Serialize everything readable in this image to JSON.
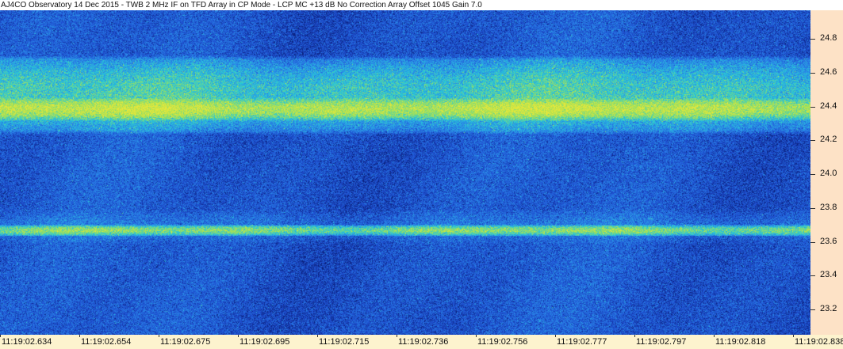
{
  "window": {
    "title": "AJ4CO Observatory 14 Dec 2015 - TWB 2 MHz IF on TFD Array in CP Mode - LCP  MC +13 dB  No Correction Array  Offset 1045  Gain 7.0"
  },
  "chart_data": {
    "type": "heatmap",
    "title": "AJ4CO Observatory 14 Dec 2015 - TWB 2 MHz IF on TFD Array in CP Mode - LCP  MC +13 dB  No Correction Array  Offset 1045  Gain 7.0",
    "xlabel": "",
    "ylabel": "",
    "x_tick_labels": [
      "11:19:02.634",
      "11:19:02.654",
      "11:19:02.675",
      "11:19:02.695",
      "11:19:02.715",
      "11:19:02.736",
      "11:19:02.756",
      "11:19:02.777",
      "11:19:02.797",
      "11:19:02.818",
      "11:19:02.838"
    ],
    "x_range": [
      "11:19:02.634",
      "11:19:02.838"
    ],
    "y_tick_values": [
      24.8,
      24.6,
      24.4,
      24.2,
      24.0,
      23.8,
      23.6,
      23.4,
      23.2
    ],
    "y_tick_labels": [
      "24.8",
      "24.6",
      "24.4",
      "24.2",
      "24.0",
      "23.8",
      "23.6",
      "23.4",
      "23.2"
    ],
    "ylim": [
      23.05,
      24.97
    ],
    "grid": false,
    "colormap": [
      "#0a1f7a",
      "#1e4fd0",
      "#2a86e8",
      "#28c8d8",
      "#9ee05a",
      "#e8e83a"
    ],
    "bands": [
      {
        "freq_min": 24.26,
        "freq_max": 24.68,
        "intensity": 0.62
      },
      {
        "freq_min": 24.32,
        "freq_max": 24.46,
        "intensity": 0.88
      },
      {
        "freq_min": 23.64,
        "freq_max": 23.7,
        "intensity": 0.75
      },
      {
        "freq_min": 23.58,
        "freq_max": 23.8,
        "intensity": 0.32
      }
    ],
    "background_intensity": 0.22
  }
}
